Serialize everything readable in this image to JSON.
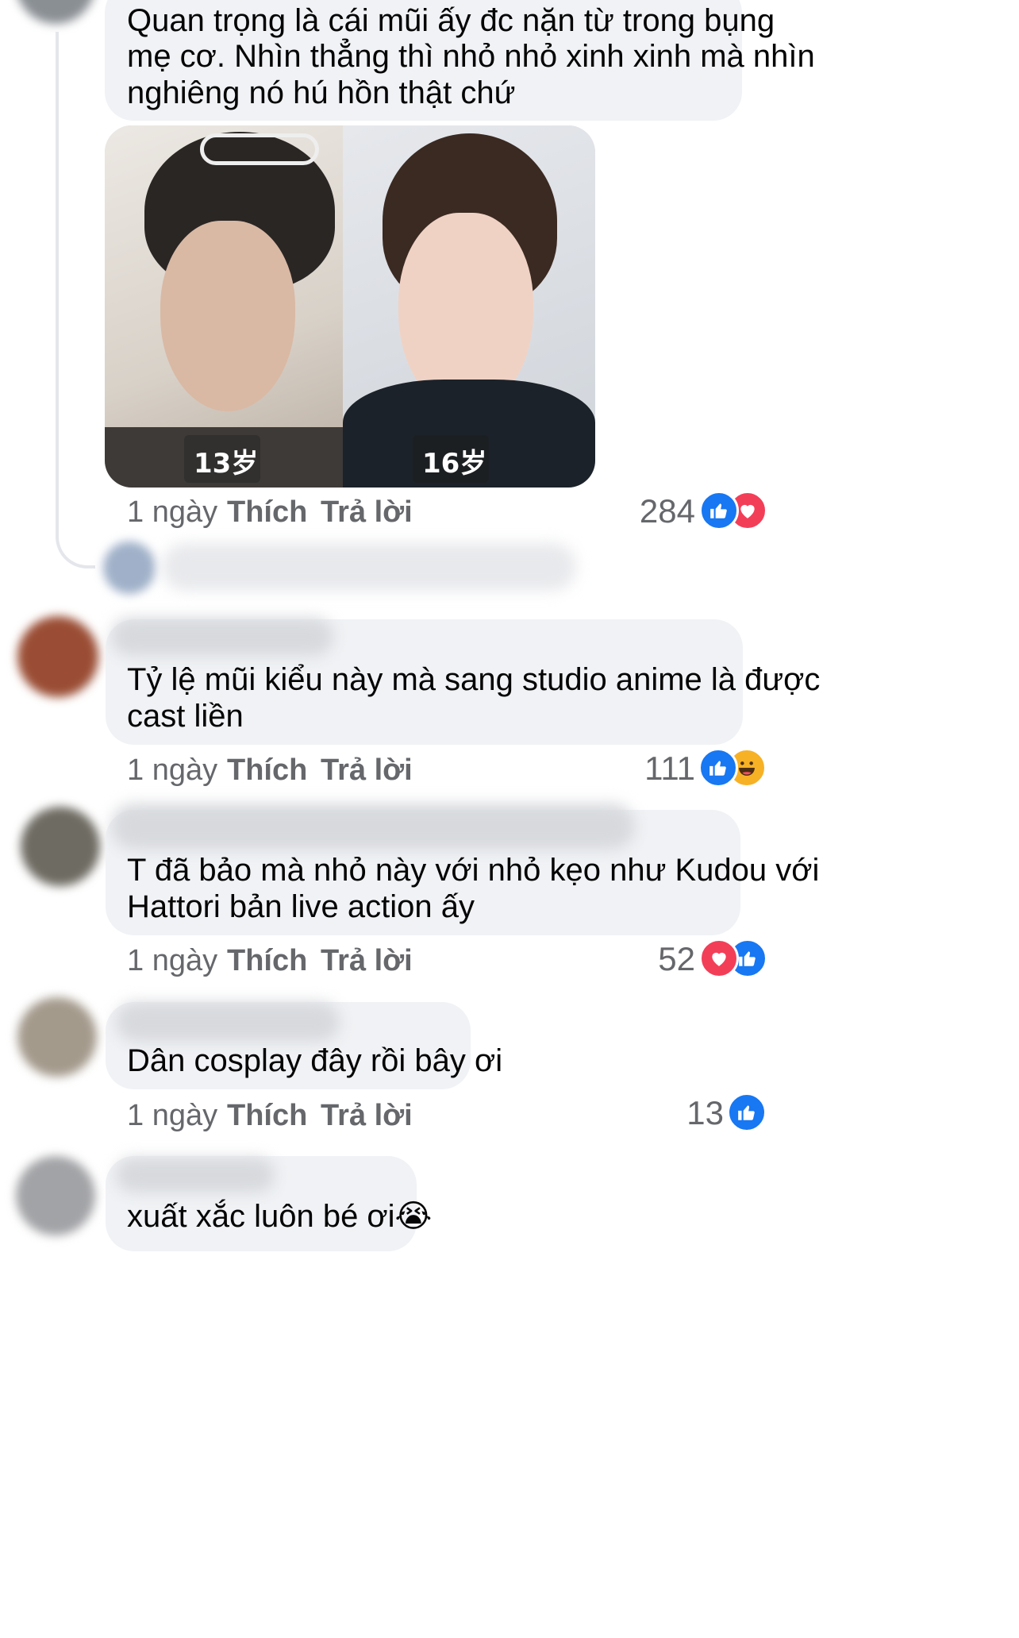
{
  "comments": [
    {
      "id": "c1",
      "text_lines": [
        "Quan trọng là cái mũi ấy đc nặn từ trong bụng",
        "mẹ cơ. Nhìn thẳng thì nhỏ nhỏ xinh xinh mà nhìn",
        "nghiêng nó hú hồn thật chứ"
      ],
      "image": {
        "left_label": "13岁",
        "right_label": "16岁"
      },
      "time": "1 ngày",
      "like_label": "Thích",
      "reply_label": "Trả lời",
      "reaction_count": "284",
      "reactions": [
        "like",
        "love"
      ]
    },
    {
      "id": "c2",
      "text_lines": [
        "Tỷ lệ mũi kiểu này mà sang studio anime là được",
        "cast liền"
      ],
      "time": "1 ngày",
      "like_label": "Thích",
      "reply_label": "Trả lời",
      "reaction_count": "111",
      "reactions": [
        "like",
        "haha"
      ]
    },
    {
      "id": "c3",
      "text_lines": [
        "T đã bảo mà nhỏ này với nhỏ kẹo như Kudou với",
        "Hattori bản live action ấy"
      ],
      "time": "1 ngày",
      "like_label": "Thích",
      "reply_label": "Trả lời",
      "reaction_count": "52",
      "reactions": [
        "love",
        "like"
      ]
    },
    {
      "id": "c4",
      "text_lines": [
        "Dân cosplay đây rồi bây ơi"
      ],
      "time": "1 ngày",
      "like_label": "Thích",
      "reply_label": "Trả lời",
      "reaction_count": "13",
      "reactions": [
        "like"
      ]
    },
    {
      "id": "c5",
      "text_lines": [
        "xuất xắc luôn bé ơi😭"
      ]
    }
  ],
  "colors": {
    "bubble": "#f0f2f5",
    "meta": "#65676b",
    "like": "#1877f2",
    "love": "#f33e58",
    "haha": "#f7b125"
  }
}
